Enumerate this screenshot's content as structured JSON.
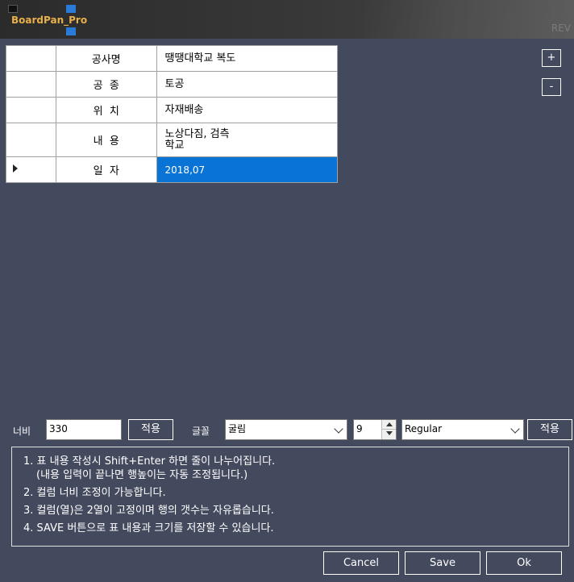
{
  "header": {
    "logo_text": "BoardPan_Pro",
    "deco_text": "REV"
  },
  "grid": {
    "rows": [
      {
        "label": "공사명",
        "value": "땡땡대학교 복도"
      },
      {
        "label": "공  종",
        "value": "토공"
      },
      {
        "label": "위  치",
        "value": "자재배송"
      },
      {
        "label": "내  용",
        "value_line1": "노상다짐, 검측",
        "value_line2": "학교"
      },
      {
        "label": "일  자",
        "value": "2018,07"
      }
    ]
  },
  "side_buttons": {
    "add": "+",
    "remove": "-"
  },
  "controls": {
    "width_label": "너비",
    "width_value": "330",
    "apply1": "적용",
    "font_label": "글꼴",
    "font_value": "굴림",
    "size_value": "9",
    "style_value": "Regular",
    "apply2": "적용"
  },
  "notes": {
    "line1": "1. 표 내용 작성시 Shift+Enter 하면 줄이 나누어집니다.",
    "line1b": "(내용 입력이 끝나면 행높이는 자동 조정됩니다.)",
    "line2": "2. 컬럼 너비 조정이 가능합니다.",
    "line3": "3. 컬럼(열)은 2열이 고정이며 행의 갯수는 자유롭습니다.",
    "line4": "4. SAVE 버튼으로 표 내용과 크기를 저장할 수 있습니다."
  },
  "footer": {
    "cancel": "Cancel",
    "save": "Save",
    "ok": "Ok"
  },
  "colors": {
    "background": "#434a5e",
    "selection": "#0a74d6",
    "logo": "#e8b04a"
  }
}
